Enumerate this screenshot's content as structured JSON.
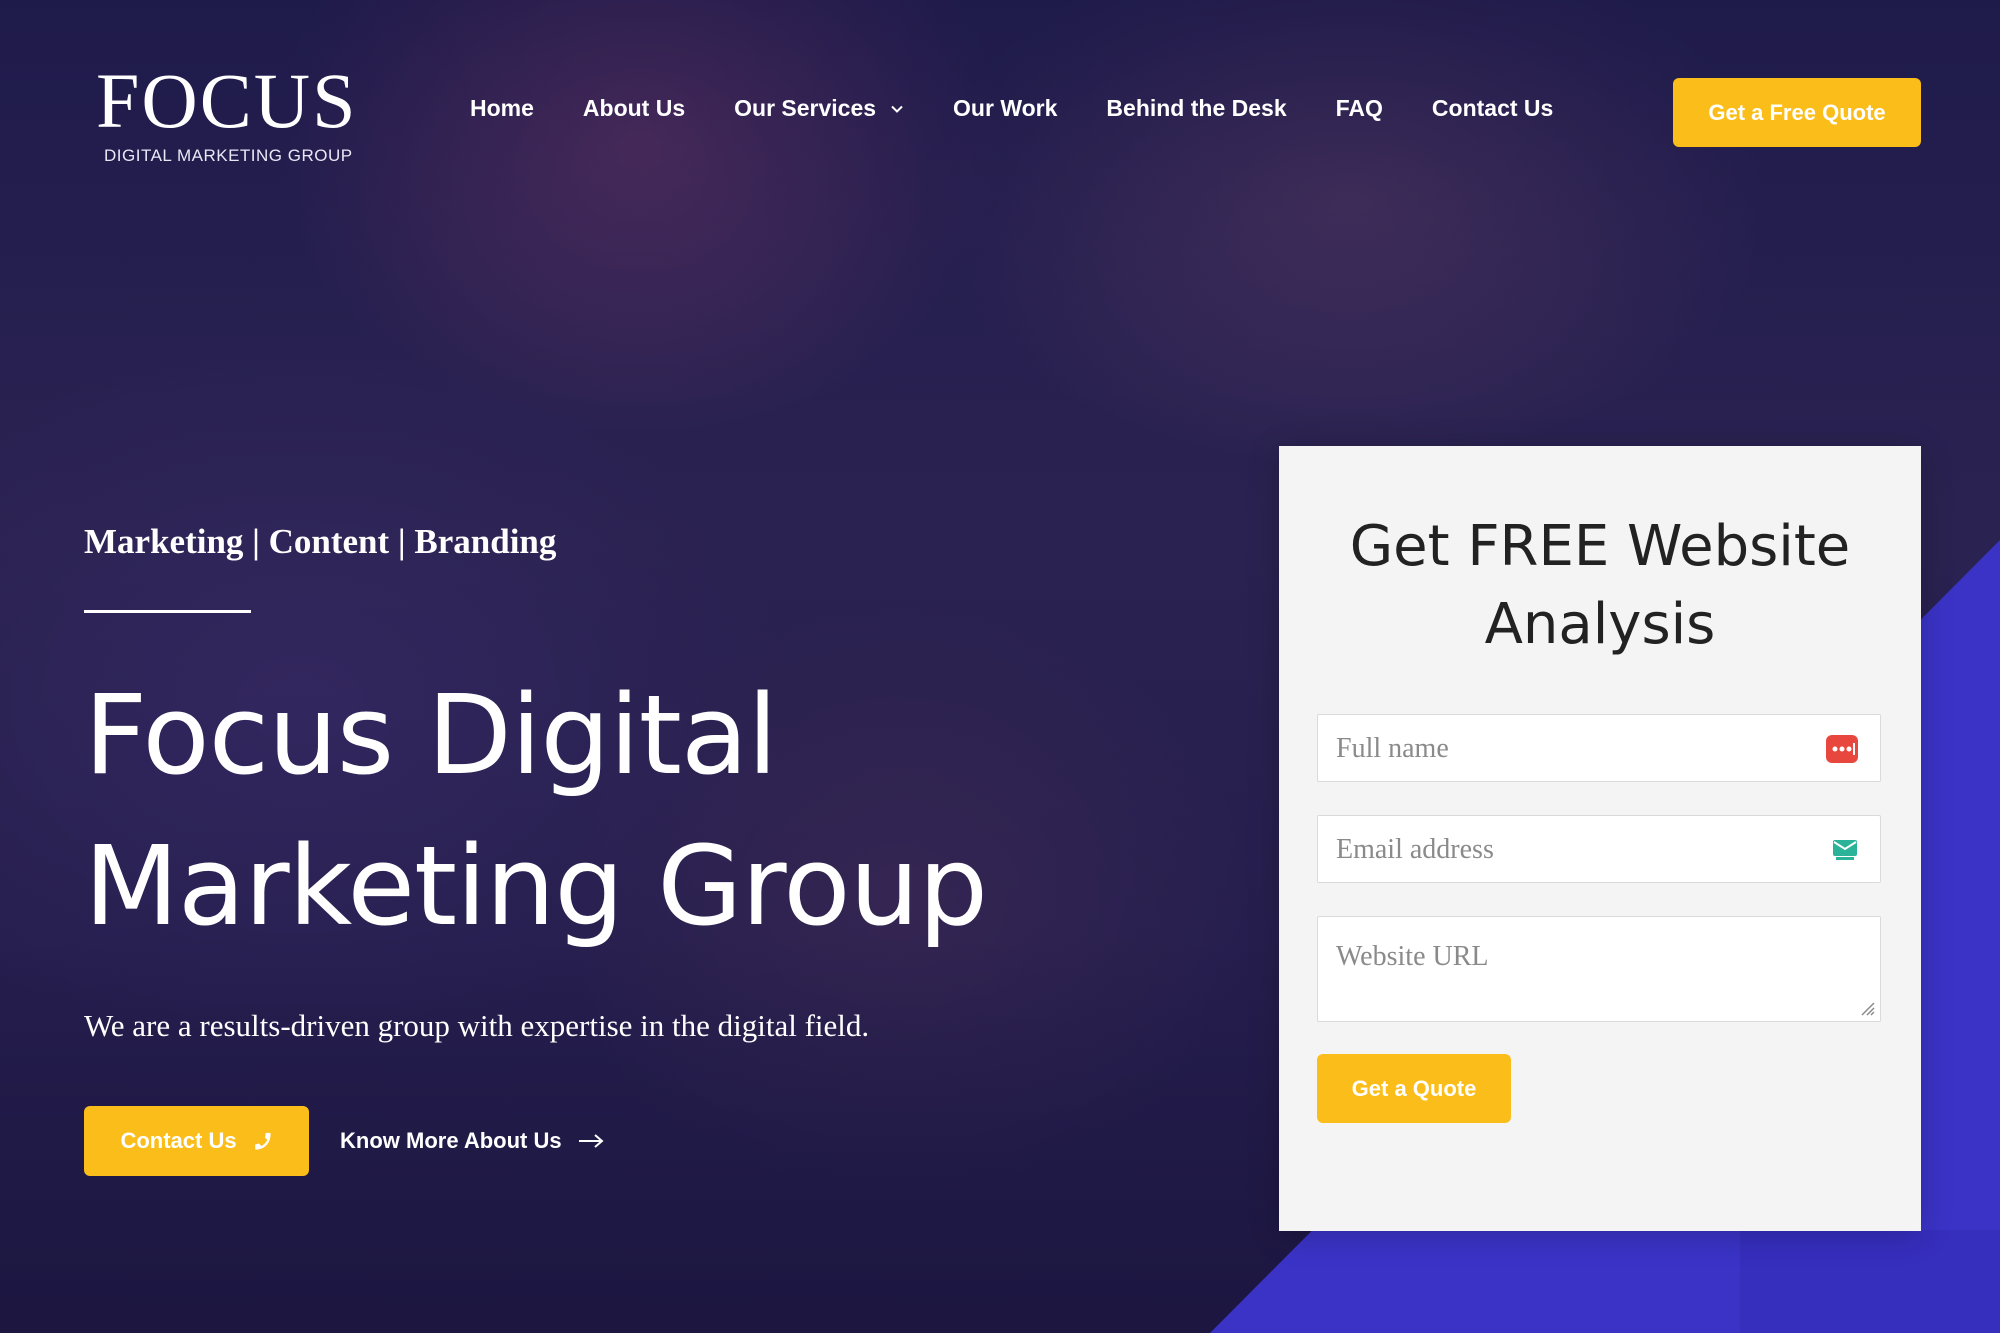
{
  "brand": {
    "logo_word": "FOCUS",
    "logo_sub": "DIGITAL MARKETING GROUP",
    "accent_color": "#fbbd19"
  },
  "nav": {
    "items": [
      {
        "label": "Home"
      },
      {
        "label": "About Us"
      },
      {
        "label": "Our Services",
        "has_dropdown": true
      },
      {
        "label": "Our Work"
      },
      {
        "label": "Behind the Desk"
      },
      {
        "label": "FAQ"
      },
      {
        "label": "Contact Us"
      }
    ],
    "cta_label": "Get a Free Quote"
  },
  "hero": {
    "tagline": "Marketing | Content | Branding",
    "title_line1": "Focus Digital",
    "title_line2": "Marketing Group",
    "description": "We are a results-driven group with expertise in the digital field.",
    "contact_label": "Contact Us",
    "contact_icon": "phone-icon",
    "more_label": "Know More About Us",
    "more_icon": "arrow-right-icon"
  },
  "form": {
    "title_line1": "Get FREE Website",
    "title_line2": "Analysis",
    "name_placeholder": "Full name",
    "email_placeholder": "Email address",
    "url_placeholder": "Website URL",
    "submit_label": "Get a Quote"
  }
}
